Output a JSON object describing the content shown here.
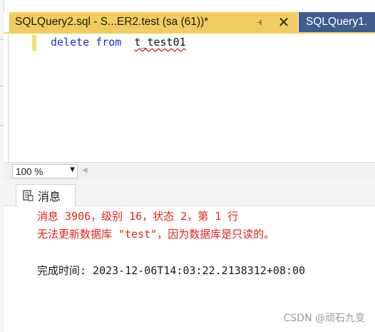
{
  "tabs": {
    "active": {
      "title": "SQLQuery2.sql - S...ER2.test (sa (61))*",
      "pin_icon": "pin-icon",
      "close_icon": "close-icon"
    },
    "inactive": {
      "title": "SQLQuery1."
    }
  },
  "editor": {
    "code": {
      "keyword1": "delete",
      "keyword2": "from",
      "table": "t_test01"
    }
  },
  "zoom": {
    "value": "100 %"
  },
  "results": {
    "tab_label": "消息",
    "tab_icon": "messages-icon",
    "error_line1": "消息 3906，级别 16，状态 2，第 1 行",
    "error_line2": "无法更新数据库 \"test\"，因为数据库是只读的。",
    "completion": "完成时间: 2023-12-06T14:03:22.2138312+08:00"
  },
  "watermark": "CSDN @顽石九变",
  "colors": {
    "tab_active_bg": "#f2cc60",
    "tab_inactive_bg": "#3f5d8c",
    "keyword": "#1f2bd6",
    "error_text": "#e2231a"
  }
}
